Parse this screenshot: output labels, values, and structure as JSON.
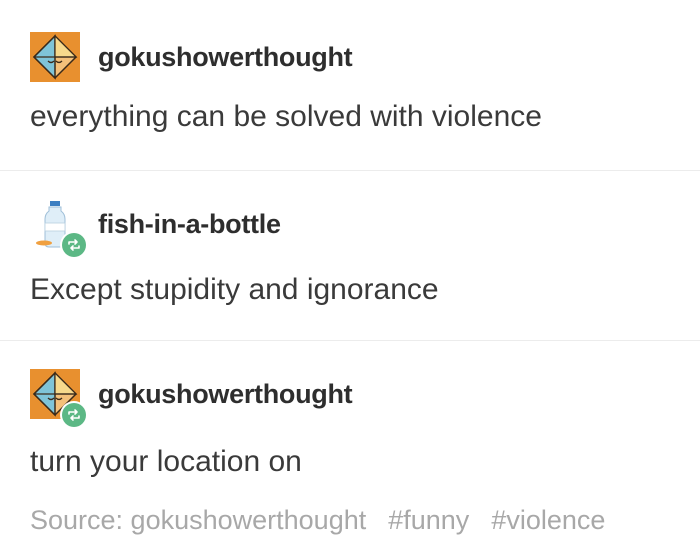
{
  "posts": [
    {
      "username": "gokushowerthought",
      "avatar_icon": "prism-avatar-icon",
      "text": "everything can be solved with violence",
      "reblog": false
    },
    {
      "username": "fish-in-a-bottle",
      "avatar_icon": "bottle-avatar-icon",
      "text": "Except stupidity and ignorance",
      "reblog": true
    },
    {
      "username": "gokushowerthought",
      "avatar_icon": "prism-avatar-icon",
      "text": "turn your location on",
      "reblog": true
    }
  ],
  "footer": {
    "source": "Source: gokushowerthought",
    "tags": [
      "#funny",
      "#violence"
    ]
  },
  "colors": {
    "reblog_badge": "#5cb885",
    "tag_text": "#a8a8a8",
    "avatar_orange": "#e8902f"
  }
}
